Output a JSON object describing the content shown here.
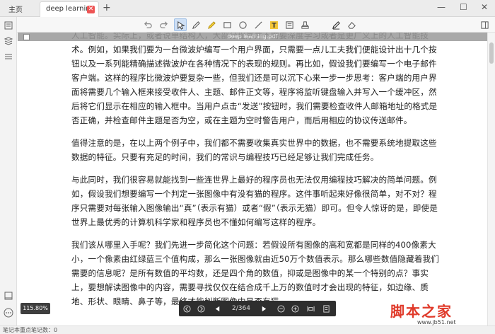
{
  "tabs": {
    "home_label": "主页",
    "doc_label": "deep learning",
    "add_symbol": "+"
  },
  "window_controls": {
    "minimize": "—",
    "maximize": "☐",
    "close": "✕"
  },
  "toolbar": {
    "tools": [
      "undo-icon",
      "redo-icon",
      "select-cursor-icon",
      "pen-icon",
      "highlighter-icon",
      "rectangle-icon",
      "circle-icon",
      "line-icon",
      "text-tool-icon",
      "note-icon",
      "stamp-icon",
      "sign-pen-icon",
      "eraser-icon"
    ],
    "text_tool_glyph": "T"
  },
  "document": {
    "filename": "deep learning.pdf",
    "paragraphs": [
      "人工智能。实际上，或者说单结构人，大部分程序并不需要深度学习或者是更广义上的人工智能技术。例如，如果我们要为一台微波炉编写一个用户界面，只需要一点儿工夫我们便能设计出十几个按钮以及一系列能精确描述微波炉在各种情况下的表现的规则。再比如，假设我们要编写一个电子邮件客户端。这样的程序比微波炉要复杂一些，但我们还是可以沉下心来一步一步思考：客户端的用户界面将需要几个输入框来接受收件人、主题、邮件正文等，程序将监听键盘输入并写入一个缓冲区，然后将它们显示在相应的输入框中。当用户点击“发送”按钮时，我们需要检查收件人邮箱地址的格式是否正确，并检查邮件主题是否为空，或在主题为空时警告用户，而后用相应的协议传送邮件。",
      "值得注意的是，在以上两个例子中，我们都不需要收集真实世界中的数据，也不需要系统地提取这些数据的特征。只要有充足的时间，我们的常识与编程技巧已经足够让我们完成任务。",
      "与此同时，我们很容易就能找到一些连世界上最好的程序员也无法仅用编程技巧解决的简单问题。例如，假设我们想要编写一个判定一张图像中有没有猫的程序。这件事听起来好像很简单，对不对？程序只需要对每张输入图像输出“真”（表示有猫）或者“假”（表示无猫）即可。但令人惊讶的是，即使是世界上最优秀的计算机科学家和程序员也不懂如何编写这样的程序。",
      "我们该从哪里入手呢？我们先进一步简化这个问题：若假设所有图像的高和宽都是同样的400像素大小，一个像素由红绿蓝三个值构成，那么一张图像就由近50万个数值表示。那么哪些数值隐藏着我们需要的信息呢？是所有数值的平均数，还是四个角的数值，抑或是图像中的某一个特别的点？事实上，要想解读图像中的内容，需要寻找仅仅在结合成千上万的数值时才会出现的特征，如边缘、质地、形状、眼睛、鼻子等，最终才能判断图像中是否有猫。"
    ]
  },
  "zoom": {
    "level": "115.80%"
  },
  "page_nav": {
    "current_page": "2",
    "total_pages": "364",
    "page_text": "2/364"
  },
  "statusbar": {
    "text": "笔记本重点笔记数：0"
  },
  "watermark": {
    "brand": "脚本之家",
    "url": "www.jb51.net"
  },
  "colors": {
    "accent_red": "#e03a2a",
    "nav_dark": "#2e2e2e",
    "active_tool": "#cfe0f5"
  }
}
